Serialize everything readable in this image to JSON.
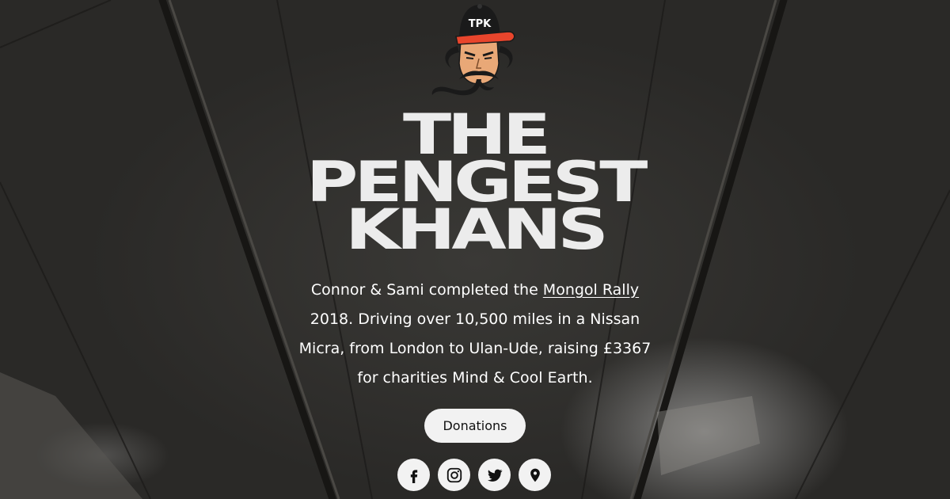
{
  "brand": {
    "logo_label": "TPK",
    "title_lines": [
      "THE",
      "PENGEST",
      "KHANS"
    ]
  },
  "intro": {
    "before_link": "Connor & Sami completed the ",
    "link_text": "Mongol Rally",
    "after_link": " 2018. Driving over 10,500 miles in a Nissan Micra, from London to Ulan-Ude, raising £3367 for charities Mind & Cool Earth."
  },
  "actions": {
    "donate_label": "Donations"
  },
  "socials": [
    {
      "icon": "facebook-icon"
    },
    {
      "icon": "instagram-icon"
    },
    {
      "icon": "twitter-icon"
    },
    {
      "icon": "map-pin-icon"
    }
  ],
  "colors": {
    "button_bg": "#f2f2f2",
    "button_text": "#111111",
    "title_text": "#ececec",
    "cap_brim": "#e8452c",
    "cap_crown": "#1a1a1a",
    "skin": "#e9a877"
  }
}
